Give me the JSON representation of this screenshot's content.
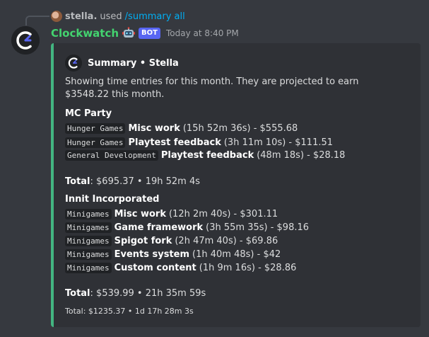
{
  "reply": {
    "user": "stella.",
    "text": "used",
    "command": "/summary all"
  },
  "message": {
    "author": "Clockwatch",
    "bot_tag": "BOT",
    "timestamp": "Today at 8:40 PM"
  },
  "embed": {
    "accent_color": "#43b581",
    "author_name": "Summary • Stella",
    "description": "Showing time entries for this month. They are projected to earn $3548.22 this month.",
    "groups": [
      {
        "title": "MC Party",
        "entries": [
          {
            "project": "Hunger Games",
            "task": "Misc work",
            "rest": "(15h 52m 36s) - $555.68"
          },
          {
            "project": "Hunger Games",
            "task": "Playtest feedback",
            "rest": "(3h 11m 10s) - $111.51"
          },
          {
            "project": "General Development",
            "task": "Playtest feedback",
            "rest": "(48m 18s) - $28.18"
          }
        ],
        "total_label": "Total",
        "total_value": ": $695.37 • 19h 52m 4s"
      },
      {
        "title": "Innit Incorporated",
        "entries": [
          {
            "project": "Minigames",
            "task": "Misc work",
            "rest": "(12h 2m 40s) - $301.11"
          },
          {
            "project": "Minigames",
            "task": "Game framework",
            "rest": "(3h 55m 35s) - $98.16"
          },
          {
            "project": "Minigames",
            "task": "Spigot fork",
            "rest": "(2h 47m 40s) - $69.86"
          },
          {
            "project": "Minigames",
            "task": "Events system",
            "rest": "(1h 40m 48s) - $42"
          },
          {
            "project": "Minigames",
            "task": "Custom content",
            "rest": "(1h 9m 16s) - $28.86"
          }
        ],
        "total_label": "Total",
        "total_value": ": $539.99 • 21h 35m 59s"
      }
    ],
    "grand_total": "Total: $1235.37 • 1d 17h 28m 3s"
  }
}
